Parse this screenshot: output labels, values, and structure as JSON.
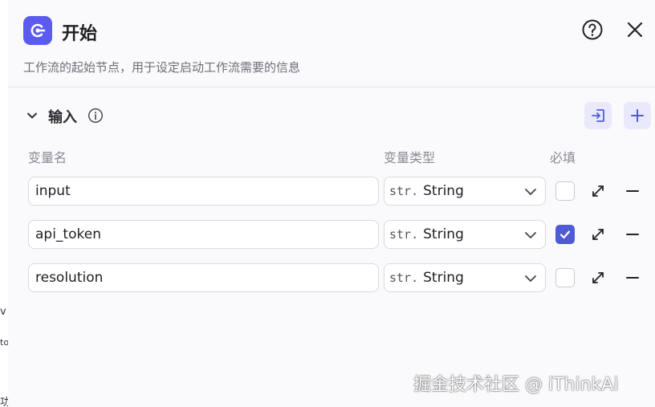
{
  "background_fragments": [
    "v",
    "to",
    "功"
  ],
  "header": {
    "title": "开始",
    "description": "工作流的起始节点，用于设定启动工作流需要的信息"
  },
  "section": {
    "title": "输入"
  },
  "columns": {
    "name": "变量名",
    "type": "变量类型",
    "required": "必填"
  },
  "rows": [
    {
      "name": "input",
      "type_prefix": "str.",
      "type": "String",
      "required": false
    },
    {
      "name": "api_token",
      "type_prefix": "str.",
      "type": "String",
      "required": true
    },
    {
      "name": "resolution",
      "type_prefix": "str.",
      "type": "String",
      "required": false
    }
  ],
  "watermark": "掘金技术社区 @ iThinkAi",
  "colors": {
    "accent": "#5b5bf0",
    "checked": "#4f5bd5",
    "tool_button_bg": "#e9e9fb"
  },
  "icons": {
    "header": "start-node-icon",
    "help": "question-circle-icon",
    "close": "close-icon",
    "collapse": "chevron-down-icon",
    "info": "info-icon",
    "import": "import-icon",
    "add": "plus-icon",
    "expand": "expand-icon",
    "remove": "minus-icon"
  }
}
